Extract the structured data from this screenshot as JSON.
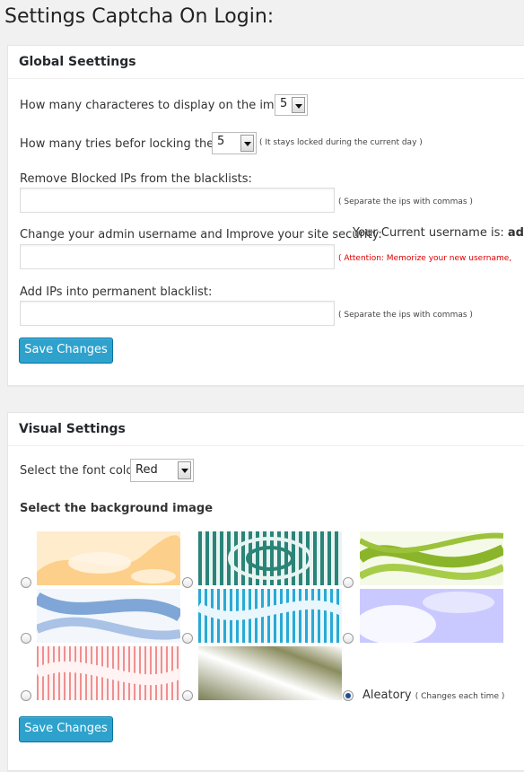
{
  "page": {
    "title": "Settings Captcha On Login:"
  },
  "global": {
    "heading": "Global Seettings",
    "chars_label": "How many characteres to display on the image",
    "chars_value": "5",
    "tries_label": "How many tries befor locking the IP",
    "tries_value": "5",
    "tries_note": "( It stays locked during the current day )",
    "remove_label": "Remove Blocked IPs from the blacklists:",
    "remove_note": "( Separate the ips with commas )",
    "username_label": "Change your admin username and Improve your site security:",
    "current_username_prefix": "Your Current username is:",
    "current_username_value": "admi",
    "username_note": "( Attention: Memorize your new username,",
    "add_label": "Add IPs into permanent blacklist:",
    "add_note": "( Separate the ips with commas )",
    "save_label": "Save Changes"
  },
  "visual": {
    "heading": "Visual Settings",
    "font_color_label": "Select the font color",
    "font_color_value": "Red",
    "bg_label": "Select the background image",
    "backgrounds": [
      {
        "name": "orange-swirl",
        "colors": [
          "#fcd08a",
          "#fff6e6"
        ]
      },
      {
        "name": "teal-moire",
        "colors": [
          "#2a8478",
          "#e8f4f2"
        ]
      },
      {
        "name": "green-wave",
        "colors": [
          "#8ab52a",
          "#f5fae8"
        ]
      },
      {
        "name": "blue-wave",
        "colors": [
          "#7fa6d6",
          "#f3f7fc"
        ]
      },
      {
        "name": "cyan-moire",
        "colors": [
          "#29a9d4",
          "#e9f7fc"
        ]
      },
      {
        "name": "lavender-swirl",
        "colors": [
          "#c9c9ff",
          "#ffffff"
        ]
      },
      {
        "name": "pink-moire",
        "colors": [
          "#ef8f8f",
          "#fff3f3"
        ]
      },
      {
        "name": "olive-gradient",
        "colors": [
          "#7c7f55",
          "#ffffff"
        ]
      }
    ],
    "aleatory_label": "Aleatory",
    "aleatory_note": "( Changes each time )",
    "selected": "aleatory",
    "save_label": "Save Changes"
  }
}
